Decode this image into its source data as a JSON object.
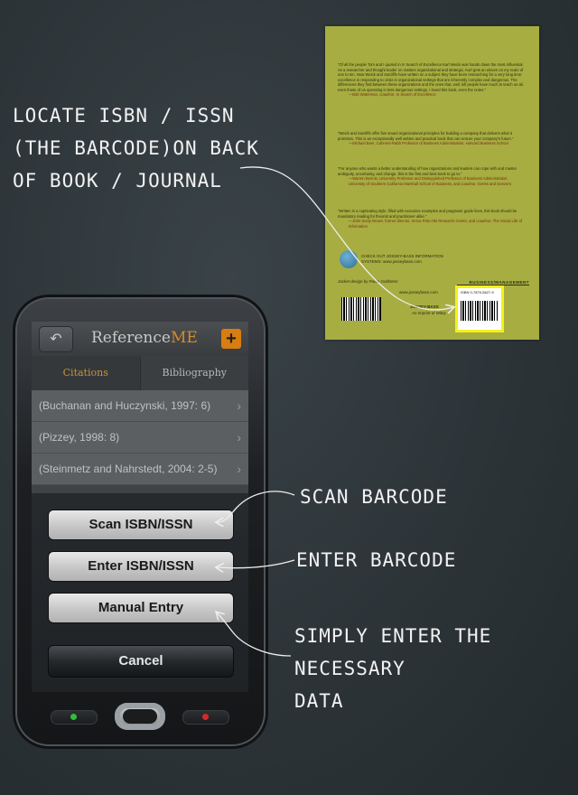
{
  "annotations": {
    "locate": "LOCATE ISBN / ISSN\n(THE BARCODE)ON BACK\nOF BOOK / JOURNAL",
    "scan": "SCAN BARCODE",
    "enter": "ENTER BARCODE",
    "manual": "SIMPLY ENTER THE\nNECESSARY\nDATA"
  },
  "app": {
    "brand_prefix": "Reference",
    "brand_suffix": "ME",
    "add_label": "+",
    "back_label": "↶",
    "tabs": [
      {
        "label": "Citations",
        "active": true
      },
      {
        "label": "Bibliography",
        "active": false
      }
    ],
    "citations": [
      "(Buchanan and Huczynski, 1997: 6)",
      "(Pizzey, 1998: 8)",
      "(Steinmetz and Nahrstedt, 2004: 2-5)"
    ],
    "actions": {
      "scan": "Scan ISBN/ISSN",
      "enter": "Enter ISBN/ISSN",
      "manual": "Manual Entry",
      "cancel": "Cancel"
    }
  },
  "colors": {
    "accent_orange": "#d87e10",
    "book_cover": "#a7ad41",
    "barcode_highlight": "#f6f01c",
    "led_green": "#2fbf3a",
    "led_red": "#d42a2a"
  },
  "book": {
    "quote1": "“Of all the people Tom and I quoted in In Search of Excellence Karl Weick was hands down the most influential. As a researcher and thought leader on matters organizational and strategic, Karl gets an eleven on my scale of one to ten. Now Weick and Sutcliffe have written on a subject they have been researching for a very long time: excellence in responding to crisis in organizational settings that are inherently complex and dangerous. The differences they find between these organizations and the ones that, well, kill people have much to teach us all, even those of us operating in less dangerous settings. I loved this book, even the notes.”",
    "quote1_by": "—Bob Waterman, coauthor, In Search of Excellence",
    "quote2": "“Weick and Sutcliffe offer five sound organizational principles for building a company that delivers what it promises. This is an exceptionally well written and practical book that can ensure your company’s future.”",
    "quote2_by": "—Michael Beer, Cahners-Rabb Professor of Business Administration, Harvard Business School",
    "quote3": "“For anyone who wants a better understanding of how organizations and leaders can cope with and master ambiguity, uncertainty, and change, this is the first and best book to go to.”",
    "quote3_by": "—Warren Bennis, University Professor and Distinguished Professor of Business Administration, University of Southern California Marshall School of Business, and coauthor, Geeks and Geezers",
    "quote4": "“Written in a captivating style, filled with executive examples and pragmatic guide lines, this book should be mandatory reading for theorist and practitioner alike.”",
    "quote4_by": "—John Seely Brown, former director, Xerox Palo Alto Research Center, and coauthor, The Social Life of Information",
    "web_line": "CHECK OUT JOSSEY-BASS INFORMATION SYSTEMS: www.josseybass.com",
    "category": "BUSINESS/MANAGEMENT",
    "jacket": "Jacket design by Paula Goldstein",
    "site": "www.josseybass.com",
    "publisher": "JOSSEY-BASS",
    "publisher_sub": "An Imprint of Wiley",
    "isbn": "ISBN 0-7879-5627-9"
  }
}
